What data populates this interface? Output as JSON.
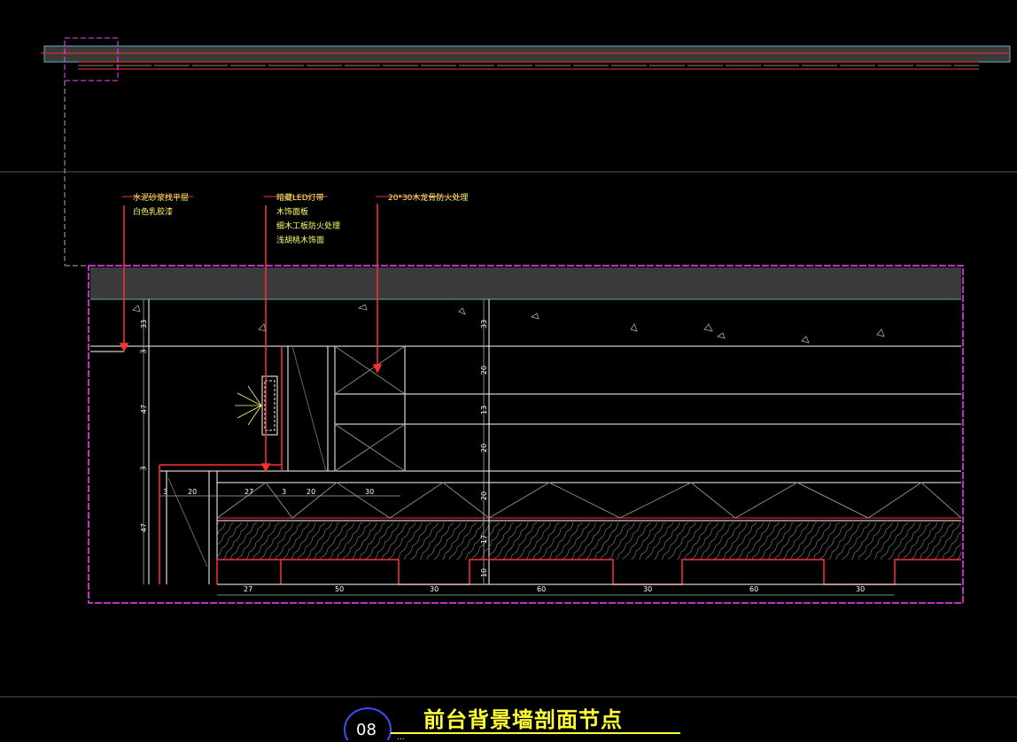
{
  "drawing": {
    "title": "前台背景墙剖面节点",
    "sheet_number": "08",
    "sub_text": "..."
  },
  "labels": {
    "left": [
      "水泥砂浆找平层",
      "白色乳胶漆"
    ],
    "middle": [
      "暗藏LED灯带",
      "木饰面板",
      "细木工板防火处理",
      "浅胡桃木饰面"
    ],
    "right": [
      "20*30木龙骨防火处理"
    ]
  },
  "dimensions": {
    "vertical_left": [
      "33",
      "3",
      "47",
      "3",
      "47"
    ],
    "vertical_right": [
      "33",
      "20",
      "13",
      "20",
      "20",
      "17",
      "10"
    ],
    "horizontal_top": [
      "3",
      "20",
      "27",
      "3",
      "20",
      "30"
    ],
    "horizontal_bottom": [
      "27",
      "50",
      "30",
      "60",
      "30",
      "60",
      "30"
    ]
  },
  "colors": {
    "background": "#000000",
    "line_white": "#ffffff",
    "line_red": "#ff2020",
    "border_magenta": "#ff40ff",
    "text_yellow": "#ffff66",
    "slab_gray": "#3a3a3a"
  }
}
